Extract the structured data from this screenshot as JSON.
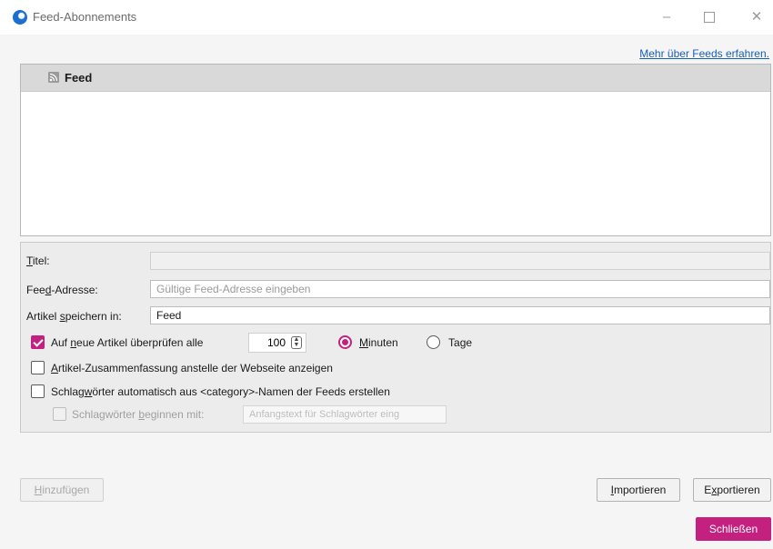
{
  "window": {
    "title": "Feed-Abonnements",
    "minimize_glyph": "–",
    "close_glyph": "✕"
  },
  "more_link": "Mehr über Feeds erfahren.",
  "tree": {
    "header_label": "Feed"
  },
  "form": {
    "title_label": {
      "pre": "",
      "accel": "T",
      "post": "itel:"
    },
    "title_value": "",
    "address_label": {
      "pre": "Fee",
      "accel": "d",
      "post": "-Adresse:"
    },
    "address_placeholder": "Gültige Feed-Adresse eingeben",
    "address_value": "",
    "store_label": {
      "pre": "Artikel ",
      "accel": "s",
      "post": "peichern in:"
    },
    "store_value": "Feed",
    "check_new": {
      "checked": true,
      "pre": "Auf ",
      "accel": "n",
      "post": "eue Artikel überprüfen alle",
      "interval_value": "100",
      "minutes": {
        "accel": "M",
        "post": "inuten",
        "selected": true
      },
      "days": {
        "pre": "Ta",
        "accel": "g",
        "post": "e",
        "selected": false
      }
    },
    "summary": {
      "checked": false,
      "accel": "A",
      "post": "rtikel-Zusammenfassung anstelle der Webseite anzeigen"
    },
    "tags_auto": {
      "checked": false,
      "pre": "Schlag",
      "accel": "w",
      "post": "örter automatisch aus <category>-Namen der Feeds erstellen"
    },
    "tags_prefix": {
      "checked": false,
      "pre": "Schlagwörter ",
      "accel": "b",
      "post": "eginnen mit:",
      "placeholder": "Anfangstext für Schlagwörter eing"
    }
  },
  "buttons": {
    "add": {
      "accel": "H",
      "post": "inzufügen"
    },
    "import": {
      "accel": "I",
      "post": "mportieren"
    },
    "export": {
      "pre": "E",
      "accel": "x",
      "post": "portieren"
    },
    "close": "Schließen"
  },
  "colors": {
    "accent": "#c3207f",
    "link": "#1a5fb4"
  }
}
